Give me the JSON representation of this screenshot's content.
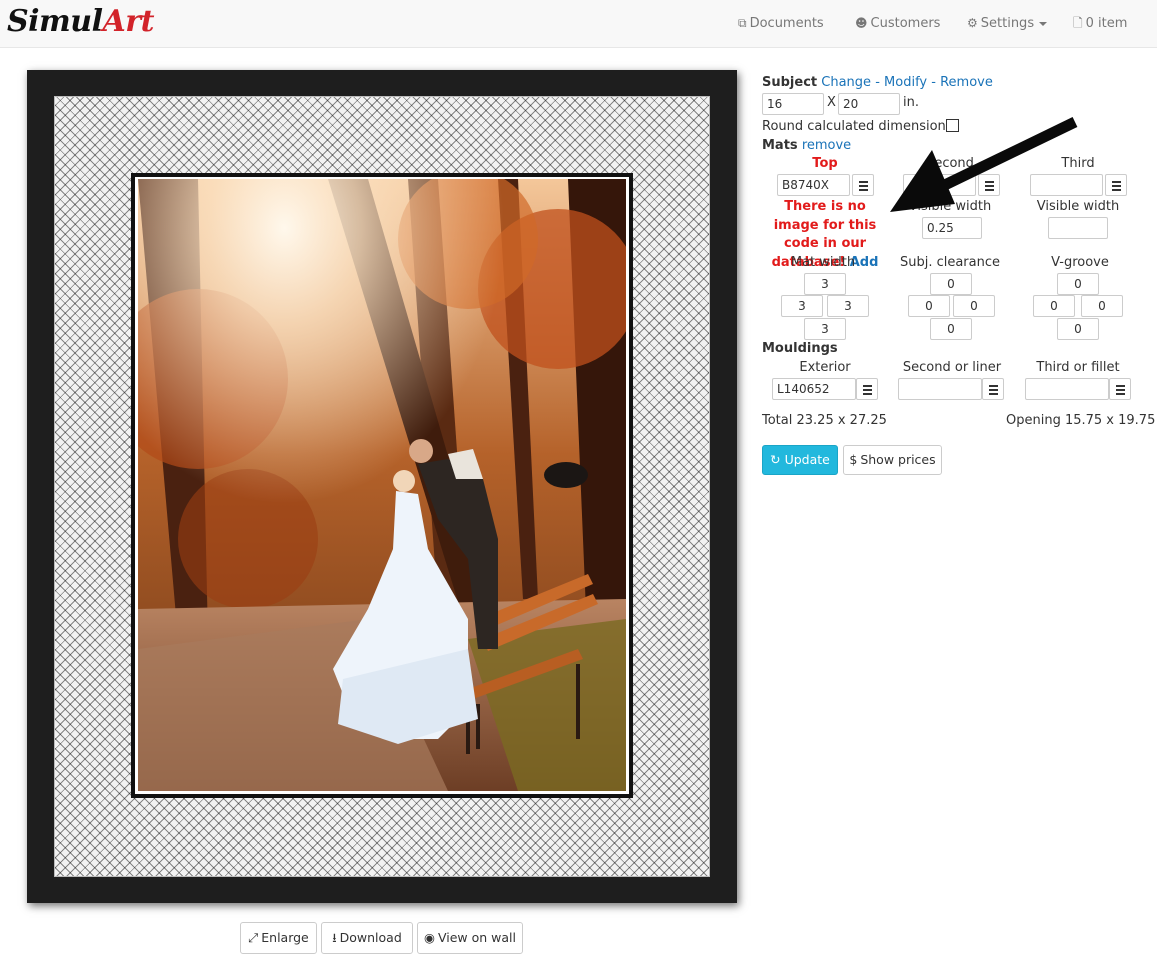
{
  "brand": {
    "part1": "Simul",
    "part2": "Art"
  },
  "nav": {
    "documents": "Documents",
    "customers": "Customers",
    "settings": "Settings",
    "cart": "0 item"
  },
  "preview": {
    "enlarge": "Enlarge",
    "download": "Download",
    "view_on_wall": "View on wall"
  },
  "subject": {
    "label": "Subject",
    "change": "Change",
    "sep1": "-",
    "modify": "Modify",
    "sep2": "-",
    "remove": "Remove",
    "width": "16",
    "x": "X",
    "height": "20",
    "unit": "in.",
    "round_label": "Round calculated dimensions"
  },
  "mats": {
    "label": "Mats",
    "remove": "remove",
    "col_top": "Top",
    "col_second": "Second",
    "col_third": "Third",
    "top_code": "B8740X",
    "third_code": "",
    "error_text": "There is no image for this code in our database!",
    "error_add": "Add",
    "visible_width_label": "Visible width",
    "second_visible_width": "0.25",
    "third_visible_width": "",
    "mat_width_label": "Mat width",
    "mat_width": {
      "top": "3",
      "left": "3",
      "right": "3",
      "bottom": "3"
    },
    "subj_clearance_label": "Subj. clearance",
    "subj_clearance": {
      "top": "0",
      "left": "0",
      "right": "0",
      "bottom": "0"
    },
    "vgroove_label": "V-groove",
    "vgroove": {
      "top": "0",
      "left": "0",
      "right": "0",
      "bottom": "0"
    }
  },
  "mouldings": {
    "label": "Mouldings",
    "exterior_label": "Exterior",
    "exterior_code": "L140652",
    "second_label": "Second or liner",
    "second_code": "",
    "third_label": "Third or fillet",
    "third_code": ""
  },
  "totals": {
    "total": "Total 23.25 x 27.25",
    "opening": "Opening 15.75 x 19.75"
  },
  "actions": {
    "update": "Update",
    "show_prices": "Show prices"
  },
  "colors": {
    "brand_red": "#d2232a",
    "link": "#1a73b8",
    "update_bg": "#22b8dd",
    "error": "#e21b1b"
  }
}
